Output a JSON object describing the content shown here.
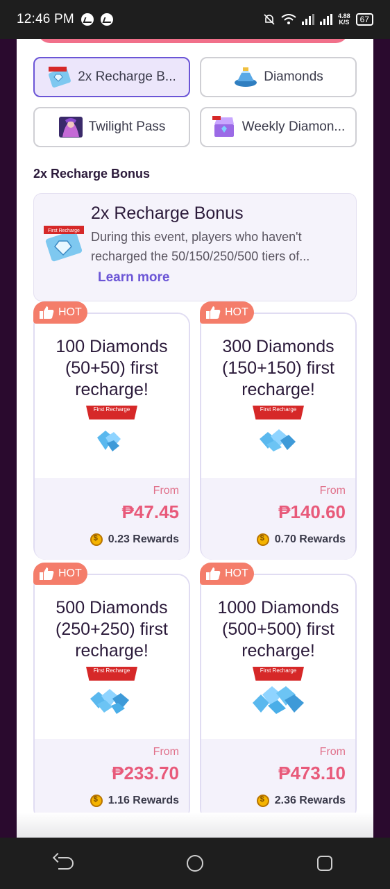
{
  "status_bar": {
    "time": "12:46 PM",
    "speed_value": "4.88",
    "speed_unit": "K/S",
    "battery": "67",
    "icons": [
      "messenger-icon",
      "messenger-icon",
      "mute-alarm-icon",
      "wifi-icon",
      "signal-icon",
      "signal-icon",
      "battery-icon"
    ]
  },
  "tabs": [
    {
      "label": "2x Recharge B...",
      "icon": "recharge-ticket-icon",
      "active": true
    },
    {
      "label": "Diamonds",
      "icon": "diamond-pile-icon",
      "active": false
    },
    {
      "label": "Twilight Pass",
      "icon": "twilight-hero-icon",
      "active": false
    },
    {
      "label": "Weekly Diamon...",
      "icon": "weekly-chest-icon",
      "active": false
    }
  ],
  "section_title": "2x Recharge Bonus",
  "promo": {
    "title": "2x Recharge Bonus",
    "description": "During this event, players who haven't recharged the 50/150/250/500 tiers of...",
    "link": "Learn more",
    "badge_text": "First Recharge"
  },
  "products": [
    {
      "hot": "HOT",
      "title": "100 Diamonds (50+50) first recharge!",
      "badge": "First Recharge",
      "from": "From",
      "price": "₱47.45",
      "rewards": "0.23 Rewards"
    },
    {
      "hot": "HOT",
      "title": "300 Diamonds (150+150) first recharge!",
      "badge": "First Recharge",
      "from": "From",
      "price": "₱140.60",
      "rewards": "0.70 Rewards"
    },
    {
      "hot": "HOT",
      "title": "500 Diamonds (250+250) first recharge!",
      "badge": "First Recharge",
      "from": "From",
      "price": "₱233.70",
      "rewards": "1.16 Rewards"
    },
    {
      "hot": "HOT",
      "title": "1000 Diamonds (500+500) first recharge!",
      "badge": "First Recharge",
      "from": "From",
      "price": "₱473.10",
      "rewards": "2.36 Rewards"
    }
  ],
  "colors": {
    "accent": "#6b55d6",
    "price": "#e85a7a",
    "hot_badge": "#f47d6a",
    "background": "#2a0a2e"
  }
}
